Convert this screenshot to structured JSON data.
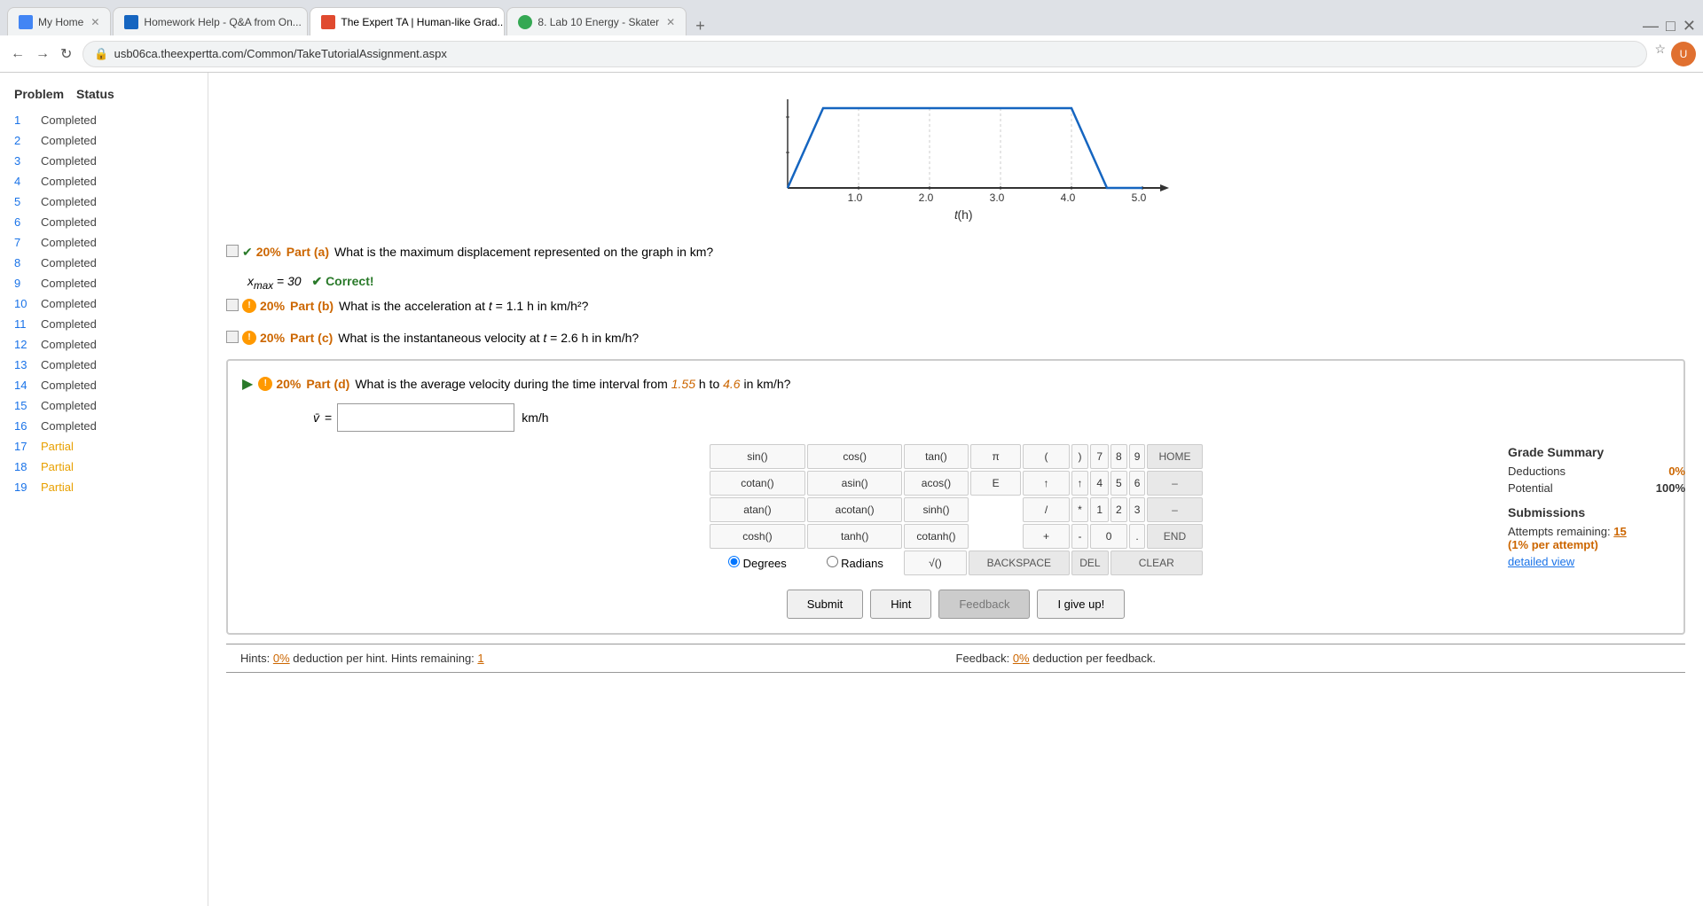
{
  "browser": {
    "tabs": [
      {
        "id": "tab1",
        "label": "My Home",
        "icon_color": "#4285f4",
        "active": false
      },
      {
        "id": "tab2",
        "label": "Homework Help - Q&A from On...",
        "icon_color": "#1565c0",
        "active": false
      },
      {
        "id": "tab3",
        "label": "The Expert TA | Human-like Grad...",
        "icon_color": "#e04a2f",
        "active": true
      },
      {
        "id": "tab4",
        "label": "8. Lab 10 Energy - Skater",
        "icon_color": "#34a853",
        "active": false
      }
    ],
    "url": "usb06ca.theexpertta.com/Common/TakeTutorialAssignment.aspx"
  },
  "sidebar": {
    "header_problem": "Problem",
    "header_status": "Status",
    "rows": [
      {
        "num": "1",
        "status": "Completed",
        "type": "completed"
      },
      {
        "num": "2",
        "status": "Completed",
        "type": "completed"
      },
      {
        "num": "3",
        "status": "Completed",
        "type": "completed"
      },
      {
        "num": "4",
        "status": "Completed",
        "type": "completed"
      },
      {
        "num": "5",
        "status": "Completed",
        "type": "completed"
      },
      {
        "num": "6",
        "status": "Completed",
        "type": "completed"
      },
      {
        "num": "7",
        "status": "Completed",
        "type": "completed"
      },
      {
        "num": "8",
        "status": "Completed",
        "type": "completed"
      },
      {
        "num": "9",
        "status": "Completed",
        "type": "completed"
      },
      {
        "num": "10",
        "status": "Completed",
        "type": "completed"
      },
      {
        "num": "11",
        "status": "Completed",
        "type": "completed"
      },
      {
        "num": "12",
        "status": "Completed",
        "type": "completed"
      },
      {
        "num": "13",
        "status": "Completed",
        "type": "completed"
      },
      {
        "num": "14",
        "status": "Completed",
        "type": "completed"
      },
      {
        "num": "15",
        "status": "Completed",
        "type": "completed"
      },
      {
        "num": "16",
        "status": "Completed",
        "type": "completed"
      },
      {
        "num": "17",
        "status": "Partial",
        "type": "partial"
      },
      {
        "num": "18",
        "status": "Partial",
        "type": "partial"
      },
      {
        "num": "19",
        "status": "Partial",
        "type": "partial"
      }
    ]
  },
  "graph": {
    "x_label": "t(h)",
    "x_ticks": [
      "1.0",
      "2.0",
      "3.0",
      "4.0",
      "5.0"
    ]
  },
  "parts": {
    "part_a": {
      "percent": "20%",
      "label": "Part (a)",
      "question": "What is the maximum displacement represented on the graph in km?",
      "answer_var": "xₘₐₓ = 30",
      "correct_text": "✔ Correct!"
    },
    "part_b": {
      "percent": "20%",
      "label": "Part (b)",
      "question": "What is the acceleration at t = 1.1 h in km/h²?"
    },
    "part_c": {
      "percent": "20%",
      "label": "Part (c)",
      "question": "What is the instantaneous velocity at t = 2.6 h in km/h?"
    },
    "part_d": {
      "percent": "20%",
      "label": "Part (d)",
      "question_prefix": "What is the average velocity during the time interval from",
      "t1": "1.55",
      "h1": "h to",
      "t2": "4.6",
      "question_suffix": "in km/h?",
      "input_var": "v̄ =",
      "unit": "km/h"
    }
  },
  "calculator": {
    "buttons_row1": [
      "sin()",
      "cos()",
      "tan()",
      "π",
      "(",
      ")",
      "7",
      "8",
      "9",
      "HOME"
    ],
    "buttons_row2": [
      "cotan()",
      "asin()",
      "acos()",
      "E",
      "↑",
      "↑",
      "4",
      "5",
      "6",
      "–"
    ],
    "buttons_row3": [
      "atan()",
      "acotan()",
      "sinh()",
      "",
      "/",
      "*",
      "1",
      "2",
      "3",
      "–"
    ],
    "buttons_row4": [
      "cosh()",
      "tanh()",
      "cotanh()",
      "",
      "+",
      "-",
      "0",
      ".",
      "END"
    ],
    "buttons_row5": [
      "√()",
      "BACKSPACE",
      "DEL",
      "CLEAR"
    ],
    "radio_degrees": "Degrees",
    "radio_radians": "Radians"
  },
  "action_buttons": {
    "submit": "Submit",
    "hint": "Hint",
    "feedback": "Feedback",
    "give_up": "I give up!"
  },
  "hints_bar": {
    "hints_label": "Hints:",
    "hints_deduction": "0%",
    "hints_text": "deduction per hint. Hints remaining:",
    "hints_remaining": "1",
    "feedback_label": "Feedback:",
    "feedback_deduction": "0%",
    "feedback_text": "deduction per feedback."
  },
  "grade_summary": {
    "title": "Grade Summary",
    "deductions_label": "Deductions",
    "deductions_value": "0%",
    "potential_label": "Potential",
    "potential_value": "100%",
    "submissions_title": "Submissions",
    "attempts_label": "Attempts remaining:",
    "attempts_value": "15",
    "attempts_note": "(1% per attempt)",
    "detail_link": "detailed view"
  }
}
